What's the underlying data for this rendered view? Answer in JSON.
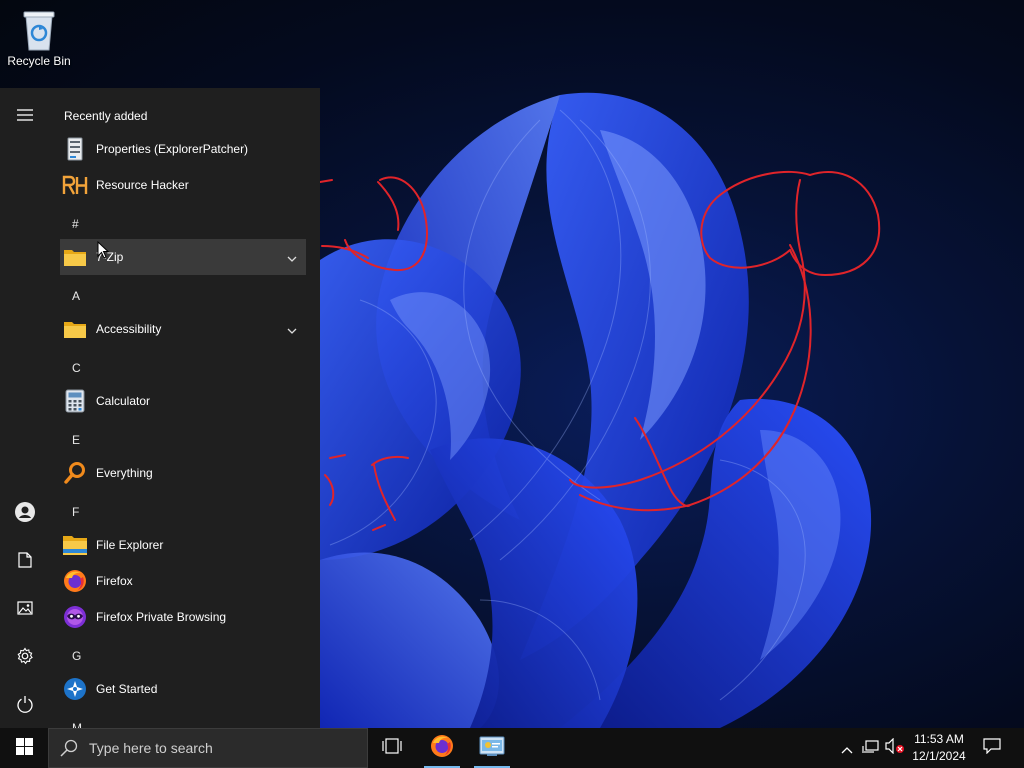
{
  "desktop": {
    "icons": [
      {
        "label": "Recycle Bin",
        "icon": "recycle-bin-icon"
      }
    ]
  },
  "start_menu": {
    "rail": [
      {
        "icon": "hamburger-menu-icon"
      },
      {
        "icon": "user-account-icon"
      },
      {
        "icon": "documents-icon"
      },
      {
        "icon": "pictures-icon"
      },
      {
        "icon": "settings-gear-icon"
      },
      {
        "icon": "power-icon"
      }
    ],
    "recently_added_label": "Recently added",
    "recent_apps": [
      {
        "label": "Properties (ExplorerPatcher)",
        "icon": "explorerpatcher-properties-icon"
      },
      {
        "label": "Resource Hacker",
        "icon": "resource-hacker-icon"
      }
    ],
    "sections": [
      {
        "letter": "#",
        "items": [
          {
            "label": "7-Zip",
            "icon": "folder-icon",
            "expandable": true,
            "hovered": true
          }
        ]
      },
      {
        "letter": "A",
        "items": [
          {
            "label": "Accessibility",
            "icon": "folder-icon",
            "expandable": true
          }
        ]
      },
      {
        "letter": "C",
        "items": [
          {
            "label": "Calculator",
            "icon": "calculator-icon"
          }
        ]
      },
      {
        "letter": "E",
        "items": [
          {
            "label": "Everything",
            "icon": "everything-search-icon"
          }
        ]
      },
      {
        "letter": "F",
        "items": [
          {
            "label": "File Explorer",
            "icon": "file-explorer-icon"
          },
          {
            "label": "Firefox",
            "icon": "firefox-icon"
          },
          {
            "label": "Firefox Private Browsing",
            "icon": "firefox-private-icon"
          }
        ]
      },
      {
        "letter": "G",
        "items": [
          {
            "label": "Get Started",
            "icon": "get-started-icon"
          }
        ]
      },
      {
        "letter": "M",
        "items": []
      }
    ]
  },
  "taskbar": {
    "search_placeholder": "Type here to search",
    "pinned": [
      {
        "icon": "task-view-icon"
      },
      {
        "icon": "firefox-icon",
        "running": true
      },
      {
        "icon": "control-panel-icon",
        "running": true
      }
    ],
    "tray": {
      "icons": [
        "show-hidden-icons-chevron-icon",
        "network-icon",
        "volume-muted-icon",
        "action-center-icon"
      ],
      "time": "11:53 AM",
      "date": "12/1/2024"
    }
  },
  "colors": {
    "start_menu_bg": "#1f1f1f",
    "taskbar_bg": "#101010",
    "hover_bg": "#3a3a3a",
    "annotation_red": "#e0242a",
    "wallpaper_blue": "#1e3cff"
  }
}
